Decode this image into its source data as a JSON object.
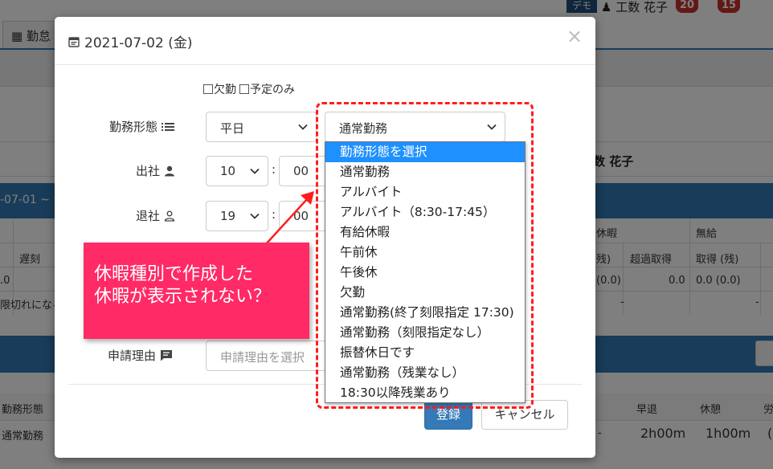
{
  "background": {
    "tab_label": "勤怠",
    "demo_badge": "デモ",
    "user_name": "工数 花子",
    "badge_one": "20",
    "badge_two": "15",
    "employee_name": "数 花子",
    "date_range": "-07-01 ~",
    "table_headers": {
      "late": "遅刻",
      "paid_leave": "休暇",
      "unpaid": "無給",
      "days": "残)",
      "over_acquired": "超過取得",
      "acquired_remaining": "取得 (残)"
    },
    "table_values": {
      "left_zero": ".0",
      "v1": "(0.0)",
      "v2": "0.0",
      "v3": "0.0 (0.0)",
      "dash1": "-",
      "dash2": "-",
      "expire_note": "限切れになる"
    },
    "table2_headers": {
      "work_type": "勤務形態",
      "early_leave": "早退",
      "break": "休憩",
      "last": "労"
    },
    "table2_values": {
      "work_type": "通常勤務",
      "early_leave": "2h00m",
      "break": "1h00m",
      "dash": "-",
      "last": "("
    }
  },
  "modal": {
    "title": "2021-07-02 (金)",
    "close_symbol": "×",
    "checkbox_absence": "欠勤",
    "checkbox_planned_only": "予定のみ",
    "labels": {
      "work_type": "勤務形態",
      "clock_in": "出社",
      "clock_out": "退社",
      "reason": "申請理由"
    },
    "day_type_value": "平日",
    "work_pattern_value": "通常勤務",
    "clock_in_hour": "10",
    "clock_in_minute": "00",
    "clock_out_hour": "19",
    "clock_out_minute": "00",
    "time_separator": ":",
    "reason_placeholder": "申請理由を選択",
    "register_button": "登録",
    "cancel_button": "キャンセル"
  },
  "dropdown": {
    "options": [
      "勤務形態を選択",
      "通常勤務",
      "アルバイト",
      "アルバイト（8:30-17:45）",
      "有給休暇",
      "午前休",
      "午後休",
      "欠勤",
      "通常勤務(終了刻限指定 17:30)",
      "通常勤務（刻限指定なし）",
      "振替休日です",
      "通常勤務（残業なし）",
      "18:30以降残業あり"
    ],
    "highlighted_index": 0
  },
  "annotation": {
    "line1": "休暇種別で作成した",
    "line2": "休暇が表示されない？"
  },
  "colors": {
    "primary": "#337ab7",
    "callout": "#ff2a66",
    "dashed_border": "#ff1e1e",
    "highlight": "#1e90ff"
  }
}
